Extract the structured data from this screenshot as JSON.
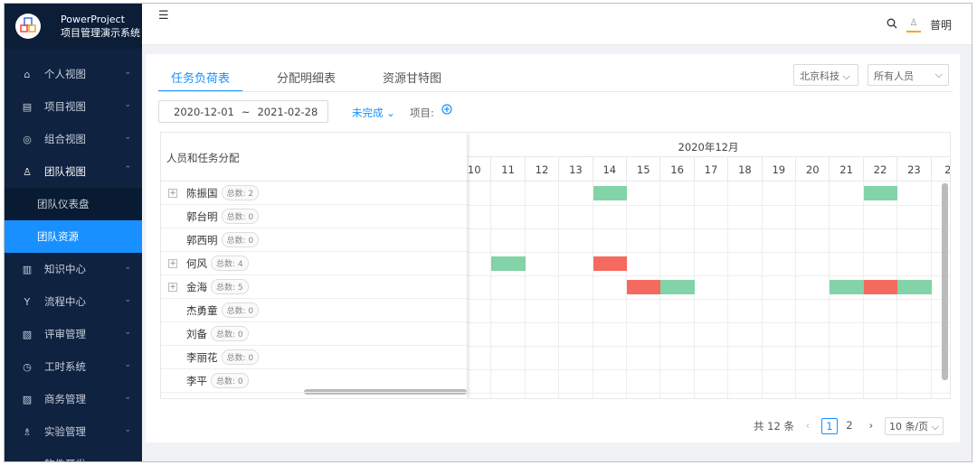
{
  "brand": {
    "line1": "PowerProject",
    "line2": "项目管理演示系统"
  },
  "menu": [
    {
      "label": "个人视图",
      "icon": "home-icon",
      "glyph": "⌂"
    },
    {
      "label": "项目视图",
      "icon": "project-icon",
      "glyph": "▤"
    },
    {
      "label": "组合视图",
      "icon": "dashboard-icon",
      "glyph": "◎"
    },
    {
      "label": "团队视图",
      "icon": "team-icon",
      "glyph": "♙"
    },
    {
      "label": "知识中心",
      "icon": "book-icon",
      "glyph": "▥"
    },
    {
      "label": "流程中心",
      "icon": "workflow-icon",
      "glyph": "Y"
    },
    {
      "label": "评审管理",
      "icon": "review-icon",
      "glyph": "▧"
    },
    {
      "label": "工时系统",
      "icon": "clock-icon",
      "glyph": "◷"
    },
    {
      "label": "商务管理",
      "icon": "business-icon",
      "glyph": "▨"
    },
    {
      "label": "实验管理",
      "icon": "lab-icon",
      "glyph": "♗"
    },
    {
      "label": "软件开发",
      "icon": "code-icon",
      "glyph": "▭"
    }
  ],
  "submenu": [
    {
      "label": "团队仪表盘"
    },
    {
      "label": "团队资源"
    }
  ],
  "header": {
    "user": "普明"
  },
  "tabs": [
    "任务负荷表",
    "分配明细表",
    "资源甘特图"
  ],
  "org_select": "北京科技",
  "people_select": "所有人员",
  "date_range": {
    "start": "2020-12-01",
    "sep": "~",
    "end": "2021-02-28"
  },
  "status_filter": "未完成",
  "project_label": "项目:",
  "gantt": {
    "left_header": "人员和任务分配",
    "month": "2020年12月",
    "days": [
      "10",
      "11",
      "12",
      "13",
      "14",
      "15",
      "16",
      "17",
      "18",
      "19",
      "20",
      "21",
      "22",
      "23",
      "2"
    ],
    "people": [
      {
        "name": "陈振国",
        "count": "总数: 2",
        "expandable": true
      },
      {
        "name": "郭台明",
        "count": "总数: 0",
        "expandable": false
      },
      {
        "name": "郭西明",
        "count": "总数: 0",
        "expandable": false
      },
      {
        "name": "何风",
        "count": "总数: 4",
        "expandable": true
      },
      {
        "name": "金海",
        "count": "总数: 5",
        "expandable": true
      },
      {
        "name": "杰勇童",
        "count": "总数: 0",
        "expandable": false
      },
      {
        "name": "刘备",
        "count": "总数: 0",
        "expandable": false
      },
      {
        "name": "李丽花",
        "count": "总数: 0",
        "expandable": false
      },
      {
        "name": "李平",
        "count": "总数: 0",
        "expandable": false
      }
    ],
    "bars": [
      {
        "row": 0,
        "day": "14",
        "status": "normal"
      },
      {
        "row": 0,
        "day": "22",
        "status": "normal"
      },
      {
        "row": 3,
        "day": "11",
        "status": "normal"
      },
      {
        "row": 3,
        "day": "14",
        "status": "overload"
      },
      {
        "row": 4,
        "day": "15",
        "status": "overload"
      },
      {
        "row": 4,
        "day": "16",
        "status": "normal"
      },
      {
        "row": 4,
        "day": "21",
        "status": "normal"
      },
      {
        "row": 4,
        "day": "22",
        "status": "overload"
      },
      {
        "row": 4,
        "day": "23",
        "status": "normal"
      }
    ],
    "colors": {
      "normal": "#82d3a7",
      "overload": "#f46a5f"
    }
  },
  "pagination": {
    "total": "共 12 条",
    "pages": [
      "1",
      "2"
    ],
    "current": "1",
    "page_size": "10 条/页"
  }
}
